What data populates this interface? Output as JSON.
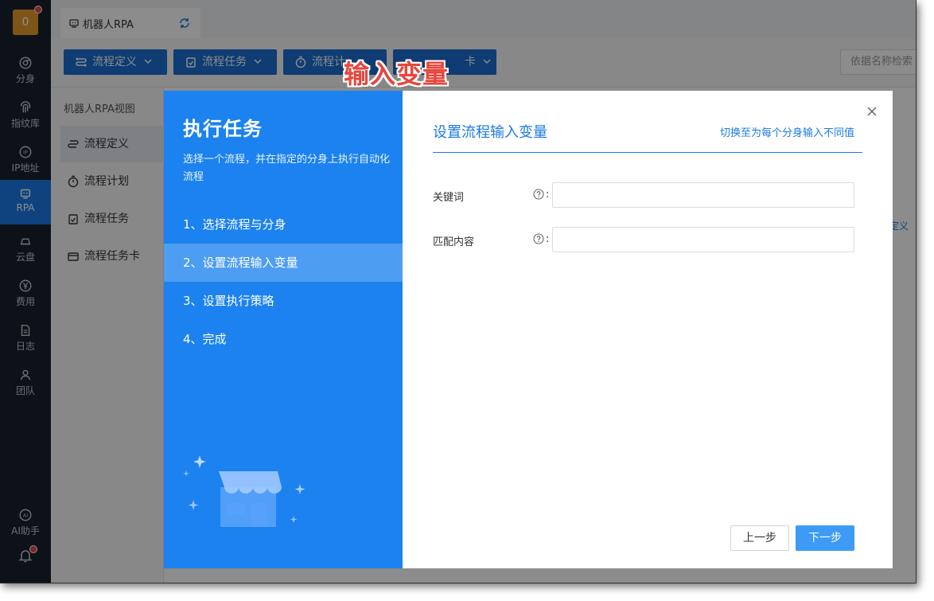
{
  "sidebar": {
    "avatar_text": "0",
    "items": [
      {
        "label": "分身",
        "icon": "chrome-icon"
      },
      {
        "label": "指纹库",
        "icon": "fingerprint-icon"
      },
      {
        "label": "IP地址",
        "icon": "ip-icon"
      },
      {
        "label": "RPA",
        "icon": "robot-icon"
      },
      {
        "label": "云盘",
        "icon": "cloud-drive-icon"
      },
      {
        "label": "费用",
        "icon": "yen-icon"
      },
      {
        "label": "日志",
        "icon": "log-icon"
      },
      {
        "label": "团队",
        "icon": "team-icon"
      },
      {
        "label": "AI助手",
        "icon": "ai-icon"
      }
    ],
    "active": "RPA"
  },
  "tabs": [
    {
      "label": "机器人RPA"
    }
  ],
  "toolbar": {
    "buttons": [
      {
        "label": "流程定义"
      },
      {
        "label": "流程任务"
      },
      {
        "label": "流程计"
      },
      {
        "label": "卡"
      }
    ],
    "search_placeholder": "依据名称检索"
  },
  "subnav": {
    "title": "机器人RPA视图",
    "items": [
      {
        "label": "流程定义"
      },
      {
        "label": "流程计划"
      },
      {
        "label": "流程任务"
      },
      {
        "label": "流程任务卡"
      }
    ]
  },
  "page": {
    "edge_text": "定义"
  },
  "modal": {
    "title": "执行任务",
    "description": "选择一个流程，并在指定的分身上执行自动化流程",
    "steps": [
      {
        "label": "1、选择流程与分身"
      },
      {
        "label": "2、设置流程输入变量"
      },
      {
        "label": "3、设置执行策略"
      },
      {
        "label": "4、完成"
      }
    ],
    "active_step": 2,
    "right": {
      "title": "设置流程输入变量",
      "switch_link": "切换至为每个分身输入不同值",
      "fields": [
        {
          "label": "关键词",
          "value": ""
        },
        {
          "label": "匹配内容",
          "value": ""
        }
      ],
      "colon": ":",
      "prev_label": "上一步",
      "next_label": "下一步"
    }
  },
  "annotation": "输入变量",
  "colors": {
    "accent": "#1b82f0",
    "sidebar_bg": "#19212e",
    "annotation": "#e8453c"
  }
}
